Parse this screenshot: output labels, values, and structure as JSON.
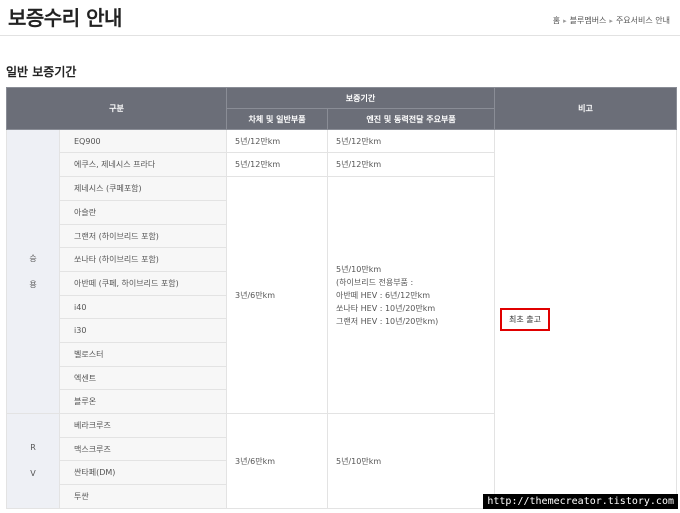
{
  "header": {
    "title": "보증수리 안내",
    "breadcrumb": [
      "홈",
      "블루멤버스",
      "주요서비스 안내"
    ]
  },
  "section": {
    "title": "일반 보증기간"
  },
  "table": {
    "col_category": "구분",
    "col_warranty": "보증기간",
    "col_body": "차체 및 일반부품",
    "col_engine": "엔진 및 동력전달 주요부품",
    "col_note": "비고",
    "groups": {
      "passenger": {
        "label_chars": [
          "승",
          "용"
        ],
        "models": [
          "EQ900",
          "에쿠스, 제네시스 프라다",
          "제네시스 (쿠페포함)",
          "아슬란",
          "그랜저 (하이브리드 포함)",
          "쏘나타 (하이브리드 포함)",
          "아반떼 (쿠페, 하이브리드 포함)",
          "i40",
          "i30",
          "벨로스터",
          "엑센트",
          "블루온"
        ],
        "eq900_body": "5년/12만km",
        "eq900_engine": "5년/12만km",
        "equus_body": "5년/12만km",
        "equus_engine": "5년/12만km",
        "general_body": "3년/6만km",
        "general_engine_lines": [
          "5년/10만km",
          "(하이브리드 전용부품 :",
          "아반떼 HEV : 6년/12만km",
          "쏘나타 HEV : 10년/20만km",
          "그랜저 HEV : 10년/20만km)"
        ]
      },
      "rv": {
        "label_chars": [
          "R",
          "V"
        ],
        "models": [
          "베라크루즈",
          "맥스크루즈",
          "싼타페(DM)",
          "투싼"
        ],
        "body": "3년/6만km",
        "engine": "5년/10만km"
      }
    },
    "note_text": "최초 출고"
  },
  "watermark": "http://themecreator.tistory.com"
}
